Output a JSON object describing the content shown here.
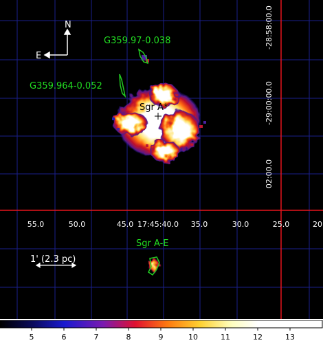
{
  "image": {
    "compass": {
      "north": "N",
      "east": "E"
    },
    "sources": {
      "g35997": "G359.97-0.038",
      "g359964": "G359.964-0.052",
      "sgr_a_star": "Sgr A*",
      "sgr_a_e": "Sgr A-E"
    },
    "scale_bar": "1' (2.3 pc)",
    "ra_ticks": [
      "55.0",
      "50.0",
      "45.0",
      "17:45:40.0",
      "35.0",
      "30.0",
      "25.0",
      "20"
    ],
    "dec_ticks": [
      "-28:58:00.0",
      "-29:00:00.0",
      "02:00.0"
    ],
    "colorbar_ticks": [
      "5",
      "6",
      "7",
      "8",
      "9",
      "10",
      "11",
      "12",
      "13"
    ],
    "colors": {
      "background": "#000000",
      "grid": "#1a1f8c",
      "crosshair": "#e8141c",
      "contour": "#22cc22",
      "label": "#22dd22",
      "text": "#ffffff"
    }
  }
}
